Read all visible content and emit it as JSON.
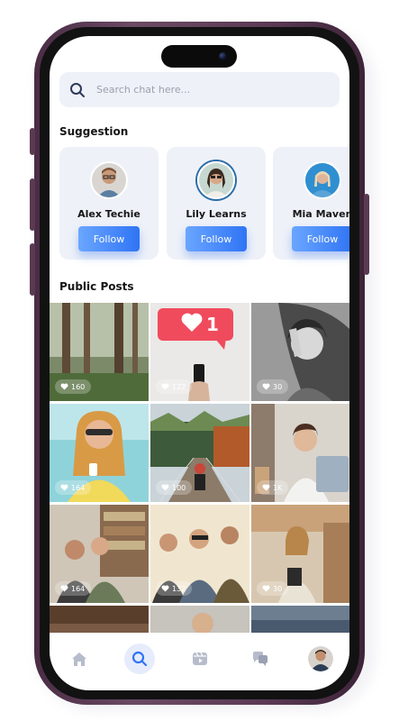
{
  "search": {
    "placeholder": "Search chat here..."
  },
  "suggestion": {
    "title": "Suggestion",
    "cards": [
      {
        "name": "Alex Techie",
        "button": "Follow"
      },
      {
        "name": "Lily Learns",
        "button": "Follow"
      },
      {
        "name": "Mia Maven",
        "button": "Follow"
      }
    ]
  },
  "posts": {
    "title": "Public Posts",
    "likes": [
      "160",
      "122",
      "30",
      "164",
      "100",
      "1K",
      "164",
      "132",
      "30"
    ]
  },
  "nav": {
    "items": [
      "home-icon",
      "search-icon",
      "reels-icon",
      "chat-icon",
      "profile-avatar"
    ],
    "active": "search-icon"
  },
  "colors": {
    "accent": "#2f74f5",
    "card_bg": "#eef1f8",
    "phone_frame": "#5b3a55"
  }
}
